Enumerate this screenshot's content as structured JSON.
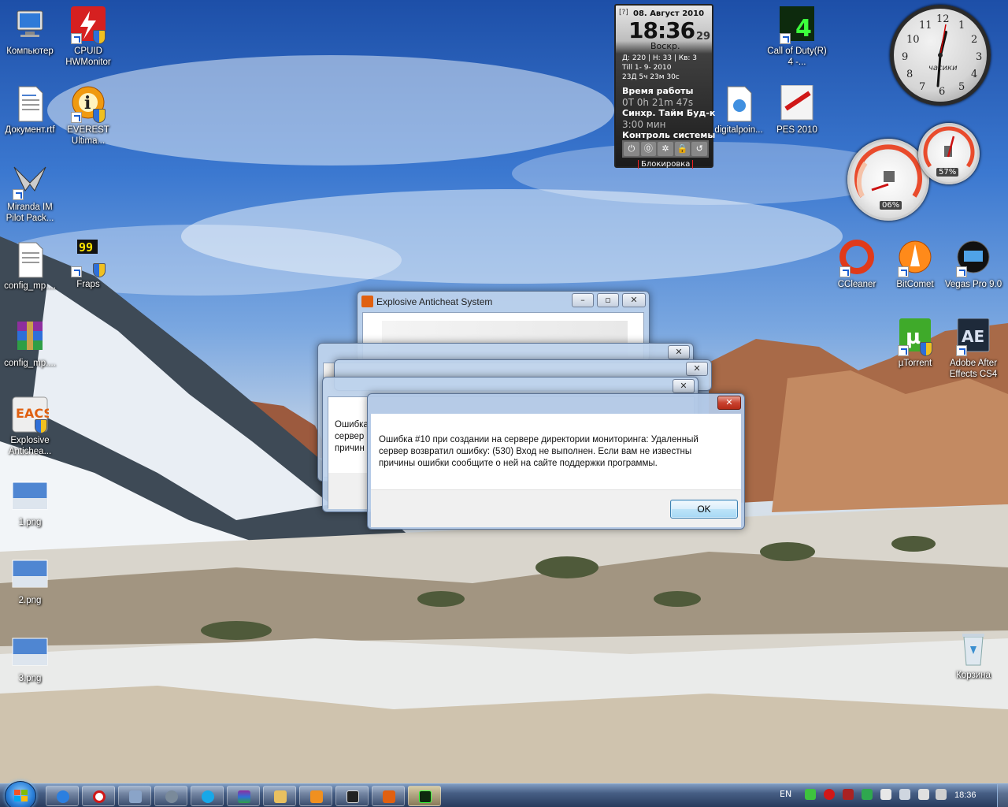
{
  "desktop": {
    "icons": [
      {
        "id": "computer",
        "label": "Компьютер"
      },
      {
        "id": "cpuid",
        "label": "CPUID HWMonitor"
      },
      {
        "id": "document",
        "label": "Документ.rtf"
      },
      {
        "id": "everest",
        "label": "EVEREST Ultima..."
      },
      {
        "id": "miranda",
        "label": "Miranda IM Pilot Pack..."
      },
      {
        "id": "config1",
        "label": "config_mp...."
      },
      {
        "id": "fraps",
        "label": "Fraps"
      },
      {
        "id": "config2",
        "label": "config_mp...."
      },
      {
        "id": "explosive",
        "label": "Explosive Anticheа..."
      },
      {
        "id": "png1",
        "label": "1.png"
      },
      {
        "id": "png2",
        "label": "2.png"
      },
      {
        "id": "png3",
        "label": "3.png"
      },
      {
        "id": "cod",
        "label": "Call of Duty(R) 4 -..."
      },
      {
        "id": "digitalpoint",
        "label": "digitalpoin..."
      },
      {
        "id": "pes",
        "label": "PES 2010"
      },
      {
        "id": "ccleaner",
        "label": "CCleaner"
      },
      {
        "id": "bitcomet",
        "label": "BitComet"
      },
      {
        "id": "vegas",
        "label": "Vegas Pro 9.0"
      },
      {
        "id": "utorrent",
        "label": "µTorrent"
      },
      {
        "id": "aftereffects",
        "label": "Adobe After Effects CS4"
      },
      {
        "id": "recycle",
        "label": "Корзина"
      }
    ]
  },
  "sysgadget": {
    "help": "[?]",
    "date": "08. Август 2010",
    "time": "18:36",
    "seconds": "29",
    "weekday": "Воскр.",
    "line1": "Д: 220 |   Н: 33 |   Кв: 3",
    "line2": "Тill 1- 9- 2010",
    "line3": "23Д 5ч 23м 30с",
    "uptime_label": "Время работы",
    "uptime": "0Т 0h 21m 47s",
    "sync_label": "Синхр.  Тайм  Буд-к",
    "sync_value": "3:00 мин",
    "control_label": "Контроль системы",
    "buttons": [
      "⏻",
      "⓪",
      "✲",
      "🔒",
      "↺"
    ],
    "lock_label": "Блокировка"
  },
  "clock_gadget": {
    "brand": "часики",
    "numbers": [
      "12",
      "1",
      "2",
      "3",
      "4",
      "5",
      "6",
      "7",
      "8",
      "9",
      "10",
      "11"
    ]
  },
  "gauges": {
    "cpu": "06%",
    "mem": "57%"
  },
  "windows": {
    "anticheat": {
      "title": "Explosive Anticheat System"
    },
    "back1_partial": [
      "Ошибка",
      "сервер",
      "причин"
    ],
    "error": {
      "message": "Ошибка #10 при создании на сервере директории мониторинга: Удаленный сервер возвратил ошибку: (530) Вход не выполнен. Если вам не известны причины ошибки сообщите о ней на сайте поддержки программы.",
      "ok": "OK",
      "close": "✕"
    },
    "min": "–",
    "max": "▫",
    "close": "✕"
  },
  "taskbar": {
    "lang": "EN",
    "time": "18:36",
    "colors": {
      "accent": "#2a7fd8"
    }
  }
}
